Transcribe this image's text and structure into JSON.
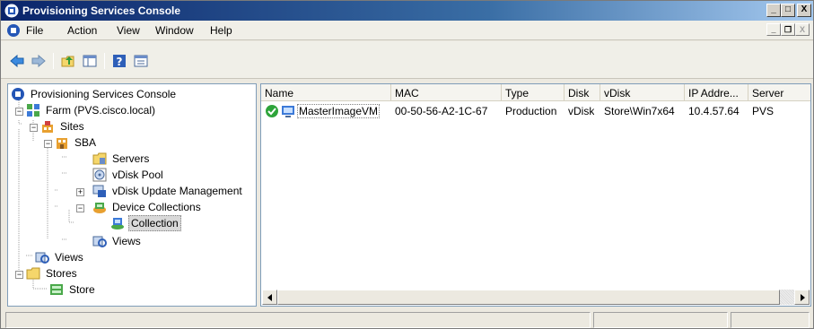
{
  "window": {
    "title": "Provisioning Services Console",
    "controls": {
      "minimize": "_",
      "maximize": "□",
      "close": "X"
    }
  },
  "menubar": {
    "items": [
      "File",
      "Action",
      "View",
      "Window",
      "Help"
    ],
    "mdi_controls": {
      "minimize": "_",
      "restore": "❐",
      "close": "X"
    }
  },
  "toolbar": {
    "icons": [
      "back-icon",
      "forward-icon",
      "up-folder-icon",
      "show-hide-tree-icon",
      "help-icon",
      "properties-icon"
    ]
  },
  "tree": {
    "nodes": [
      {
        "label": "Provisioning Services Console",
        "icon": "console-icon"
      },
      {
        "label": "Farm (PVS.cisco.local)",
        "icon": "farm-icon"
      },
      {
        "label": "Sites",
        "icon": "sites-icon"
      },
      {
        "label": "SBA",
        "icon": "site-icon"
      },
      {
        "label": "Servers",
        "icon": "servers-icon"
      },
      {
        "label": "vDisk Pool",
        "icon": "vdisk-pool-icon"
      },
      {
        "label": "vDisk Update Management",
        "icon": "vdisk-update-icon"
      },
      {
        "label": "Device Collections",
        "icon": "device-collections-icon"
      },
      {
        "label": "Collection",
        "icon": "collection-icon"
      },
      {
        "label": "Views",
        "icon": "views-icon"
      },
      {
        "label": "Views",
        "icon": "views-icon"
      },
      {
        "label": "Stores",
        "icon": "stores-icon"
      },
      {
        "label": "Store",
        "icon": "store-icon"
      }
    ],
    "selected": "Collection"
  },
  "list": {
    "columns": [
      "Name",
      "MAC",
      "Type",
      "Disk",
      "vDisk",
      "IP Addre...",
      "Server"
    ],
    "rows": [
      {
        "name": "MasterImageVM",
        "mac": "00-50-56-A2-1C-67",
        "type": "Production",
        "disk": "vDisk",
        "vdisk": "Store\\Win7x64",
        "ip": "10.4.57.64",
        "server": "PVS"
      }
    ]
  },
  "colors": {
    "title_gradient_start": "#0a246a",
    "title_gradient_end": "#a6caf0",
    "status_ok": "#2ea43a",
    "selection_bg": "#d9d9d9"
  }
}
